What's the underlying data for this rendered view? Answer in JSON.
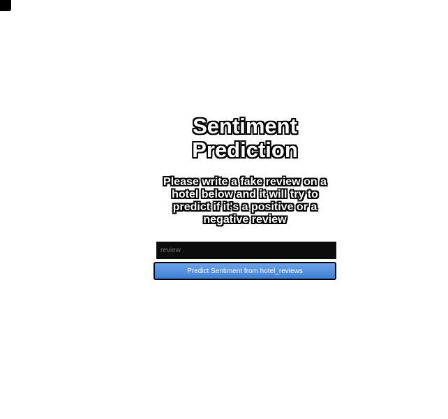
{
  "title": "Sentiment Prediction",
  "description": "Please write a fake review on a hotel below and it will try to predict if it's a positive or a negative review",
  "input": {
    "placeholder": "review",
    "value": ""
  },
  "button_label": "Predict Sentiment from hotel_reviews",
  "colors": {
    "button": "#4a8ae0",
    "input_bg": "#0c0c0c"
  }
}
